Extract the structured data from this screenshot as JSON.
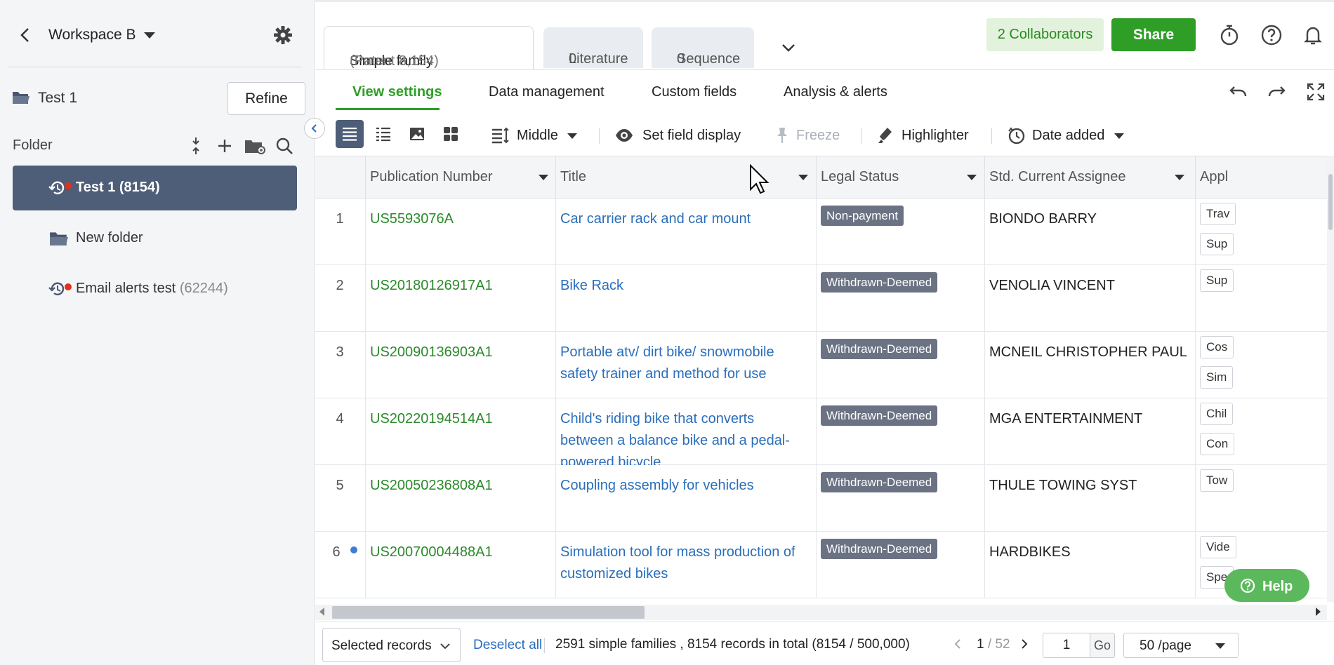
{
  "sidebar": {
    "workspace_name": "Workspace B",
    "project_name": "Test 1",
    "refine_label": "Refine",
    "folder_title": "Folder",
    "items": [
      {
        "label": "Test 1 (8154)",
        "count": ""
      },
      {
        "label": "New folder",
        "count": ""
      },
      {
        "label": "Email alerts test",
        "count": "(62244)"
      }
    ]
  },
  "tabs": [
    {
      "label": "Simple family",
      "count": "(Patent 8,154)"
    },
    {
      "label": "Literature",
      "count": "0"
    },
    {
      "label": "Sequence",
      "count": "0"
    }
  ],
  "header": {
    "collaborators_label": "2 Collaborators",
    "share_label": "Share"
  },
  "subtabs": [
    "View settings",
    "Data management",
    "Custom fields",
    "Analysis & alerts"
  ],
  "toolbar": {
    "density_label": "Middle",
    "field_display_label": "Set field display",
    "freeze_label": "Freeze",
    "highlighter_label": "Highlighter",
    "sort_label": "Date added"
  },
  "table": {
    "columns": [
      "Publication Number",
      "Title",
      "Legal Status",
      "Std. Current Assignee",
      "Appl"
    ],
    "rows": [
      {
        "num": "1",
        "pub": "US5593076A",
        "title": "Car carrier rack and car mount",
        "status": "Non-payment",
        "assignee": "BIONDO BARRY",
        "chips": [
          "Trav",
          "Sup"
        ]
      },
      {
        "num": "2",
        "pub": "US20180126917A1",
        "title": "Bike Rack",
        "status": "Withdrawn-Deemed",
        "assignee": "VENOLIA VINCENT",
        "chips": [
          "Sup"
        ]
      },
      {
        "num": "3",
        "pub": "US20090136903A1",
        "title": "Portable atv/ dirt bike/ snowmobile safety trainer and method for use",
        "status": "Withdrawn-Deemed",
        "assignee": "MCNEIL CHRISTOPHER PAUL",
        "chips": [
          "Cos",
          "Sim"
        ]
      },
      {
        "num": "4",
        "pub": "US20220194514A1",
        "title": "Child's riding bike that converts between a balance bike and a pedal-powered bicycle",
        "status": "Withdrawn-Deemed",
        "assignee": "MGA ENTERTAINMENT",
        "chips": [
          "Chil",
          "Con"
        ]
      },
      {
        "num": "5",
        "pub": "US20050236808A1",
        "title": "Coupling assembly for vehicles",
        "status": "Withdrawn-Deemed",
        "assignee": "THULE TOWING SYST",
        "chips": [
          "Tow"
        ]
      },
      {
        "num": "6",
        "pub": "US20070004488A1",
        "title": "Simulation tool for mass production of customized bikes",
        "status": "Withdrawn-Deemed",
        "assignee": "HARDBIKES",
        "chips": [
          "Vide",
          "Spe"
        ]
      }
    ]
  },
  "help_label": "Help",
  "footer": {
    "selected_records": "Selected records",
    "deselect_all": "Deselect all",
    "records_info": "2591 simple families , 8154 records in total (8154 / 500,000)",
    "current_page": "1",
    "total_pages": "/ 52",
    "goto_value": "1",
    "go_label": "Go",
    "per_page": "50 /page"
  },
  "colors": {
    "accent_green": "#2f9e27",
    "selected_item": "#4f5e78",
    "link_blue": "#2a6ebb",
    "status_badge": "#6b7283"
  }
}
